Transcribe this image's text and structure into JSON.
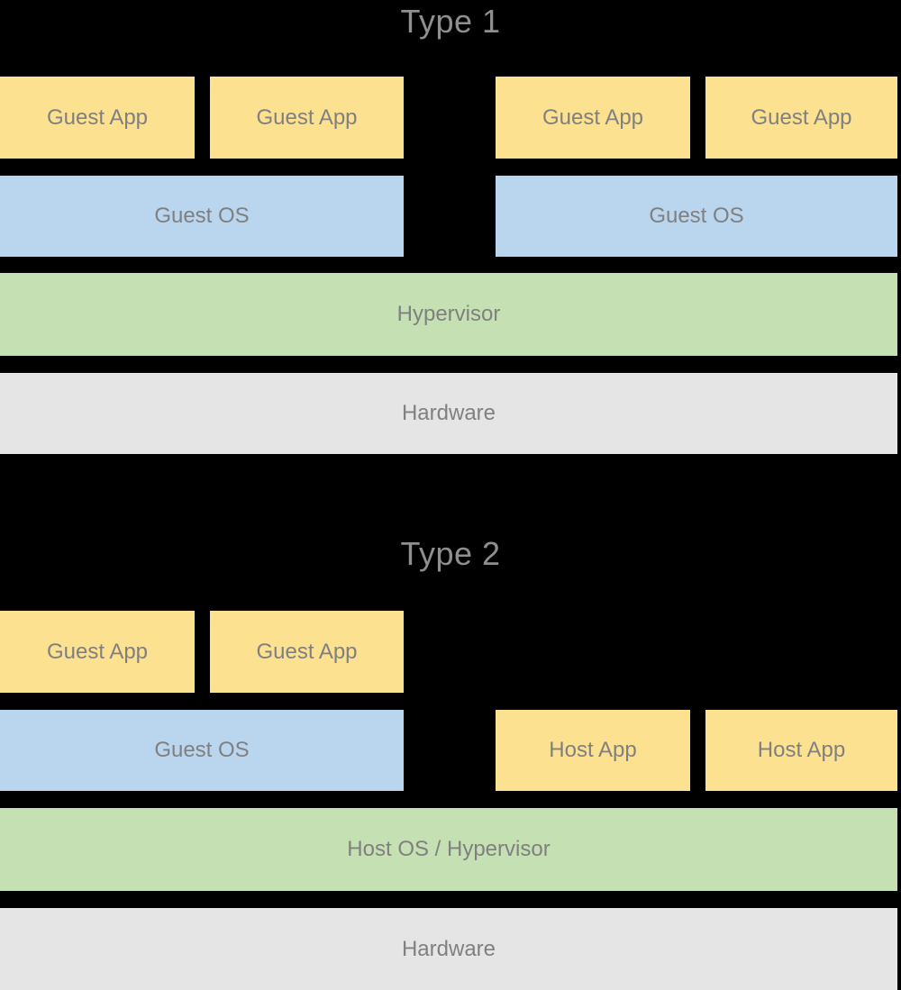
{
  "diagram": {
    "background_color": "#000000",
    "text_color": "#808080",
    "title_color": "#8f8f8f",
    "colors": {
      "app": "#fce191",
      "guest_os": "#bad5ee",
      "hypervisor": "#c5e0b3",
      "hardware": "#e5e5e5"
    }
  },
  "type1": {
    "title": "Type 1",
    "apps": [
      {
        "label": "Guest App"
      },
      {
        "label": "Guest App"
      },
      {
        "label": "Guest App"
      },
      {
        "label": "Guest App"
      }
    ],
    "guest_os": [
      {
        "label": "Guest OS"
      },
      {
        "label": "Guest OS"
      }
    ],
    "hypervisor": {
      "label": "Hypervisor"
    },
    "hardware": {
      "label": "Hardware"
    }
  },
  "type2": {
    "title": "Type 2",
    "guest_apps": [
      {
        "label": "Guest App"
      },
      {
        "label": "Guest App"
      }
    ],
    "guest_os": {
      "label": "Guest OS"
    },
    "host_apps": [
      {
        "label": "Host App"
      },
      {
        "label": "Host App"
      }
    ],
    "hypervisor": {
      "label": "Host OS / Hypervisor"
    },
    "hardware": {
      "label": "Hardware"
    }
  }
}
